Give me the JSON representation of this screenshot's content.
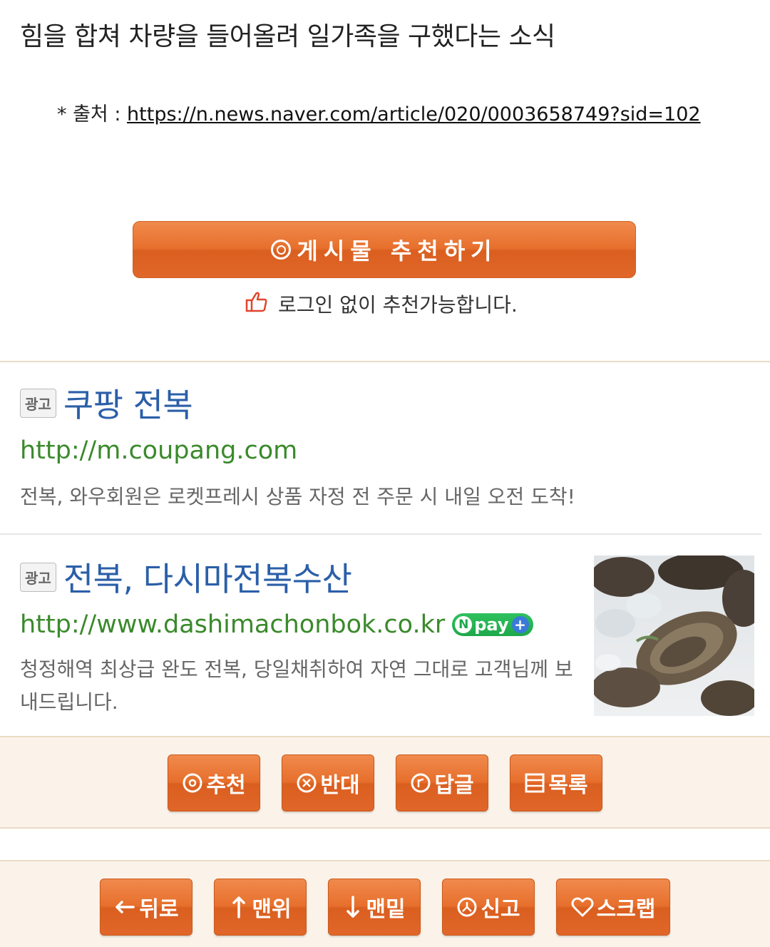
{
  "article": {
    "headline": "힘을 합쳐 차량을 들어올려 일가족을 구했다는 소식",
    "source_label": "* 출처 : ",
    "source_url": "https://n.news.naver.com/article/020/0003658749?sid=102"
  },
  "recommend": {
    "button_label": "게시물 추천하기",
    "note": "로그인 없이 추천가능합니다."
  },
  "ads": [
    {
      "badge": "광고",
      "title": "쿠팡 전복",
      "url": "http://m.coupang.com",
      "description": "전복, 와우회원은 로켓프레시 상품 자정 전 주문 시 내일 오전 도착!"
    },
    {
      "badge": "광고",
      "title": "전복, 다시마전복수산",
      "url": "http://www.dashimachonbok.co.kr",
      "npay": "pay",
      "description": "청정해역 최상급 완도 전복, 당일채취하여 자연 그대로 고객님께 보내드립니다."
    }
  ],
  "actions": {
    "recommend": "추천",
    "oppose": "반대",
    "reply": "답글",
    "list": "목록"
  },
  "nav": {
    "back": "뒤로",
    "top": "맨위",
    "bottom": "맨밑",
    "report": "신고",
    "scrap": "스크랩"
  },
  "colors": {
    "accent_orange": "#e76f2c",
    "ad_title_blue": "#2b5fa8",
    "ad_url_green": "#3a8a2b",
    "bar_bg": "#fbf3ea"
  }
}
